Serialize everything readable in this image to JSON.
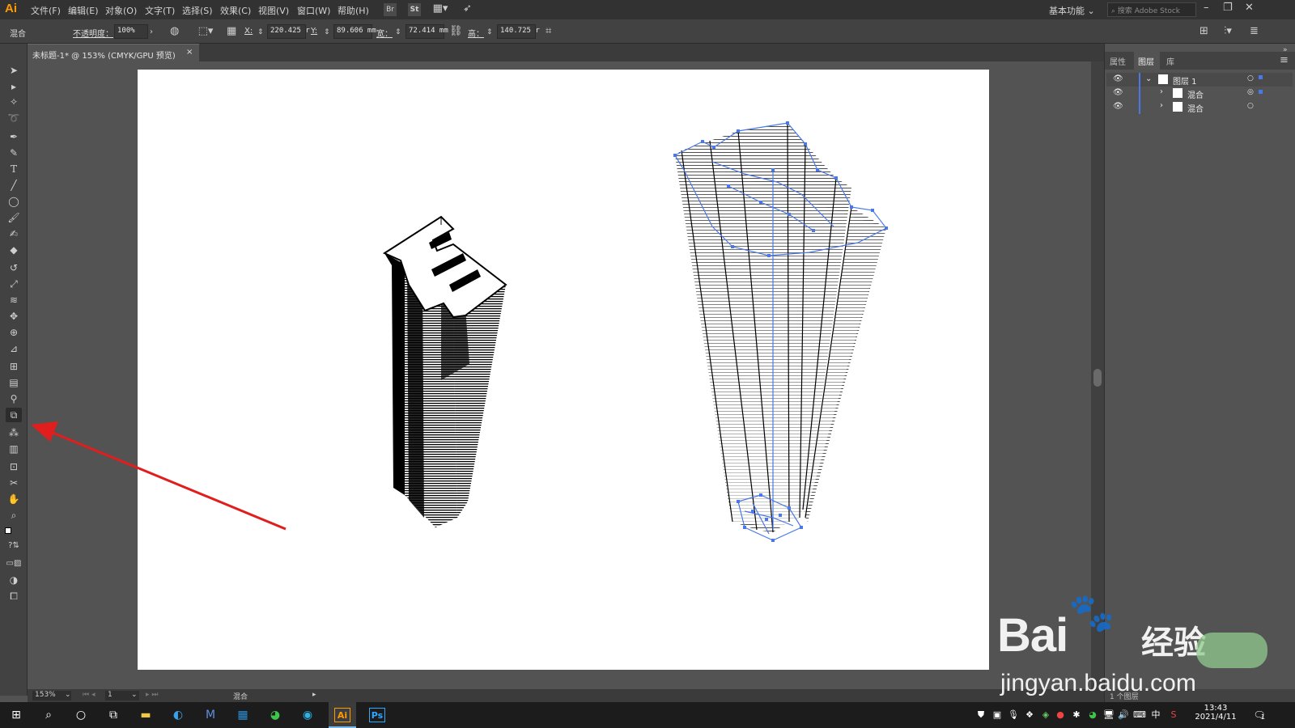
{
  "app": {
    "logo": "Ai"
  },
  "menu": [
    "文件(F)",
    "编辑(E)",
    "对象(O)",
    "文字(T)",
    "选择(S)",
    "效果(C)",
    "视图(V)",
    "窗口(W)",
    "帮助(H)"
  ],
  "menubar_right": {
    "workspace": "基本功能",
    "search_placeholder": "搜索 Adobe Stock",
    "st_label": "St"
  },
  "control": {
    "object_type": "混合",
    "opacity_label": "不透明度：",
    "opacity_value": "100%",
    "x_label": "X:",
    "x_value": "220.425 r",
    "y_label": "Y:",
    "y_value": "89.606 mm",
    "w_label": "宽：",
    "w_value": "72.414 mm",
    "h_label": "高：",
    "h_value": "140.725 r"
  },
  "document": {
    "tab_title": "未标题-1* @ 153% (CMYK/GPU 预览)",
    "close": "×"
  },
  "status": {
    "zoom": "153%",
    "artboard_num": "1",
    "object": "混合"
  },
  "panel": {
    "tabs": [
      "属性",
      "图层",
      "库"
    ],
    "layers": [
      {
        "name": "图层 1",
        "level": 0
      },
      {
        "name": "混合",
        "level": 1
      },
      {
        "name": "混合",
        "level": 1
      }
    ],
    "footer": "1 个图层"
  },
  "taskbar": {
    "time": "13:43",
    "date": "2021/4/11",
    "ime": "中",
    "notif_count": "1"
  },
  "watermark": {
    "brand": "Bai",
    "brand2": "经验",
    "url": "jingyan.baidu.com"
  },
  "colors": {
    "selection": "#4a78e8",
    "arrow": "#e11e1e",
    "accent": "#ff9a00"
  }
}
